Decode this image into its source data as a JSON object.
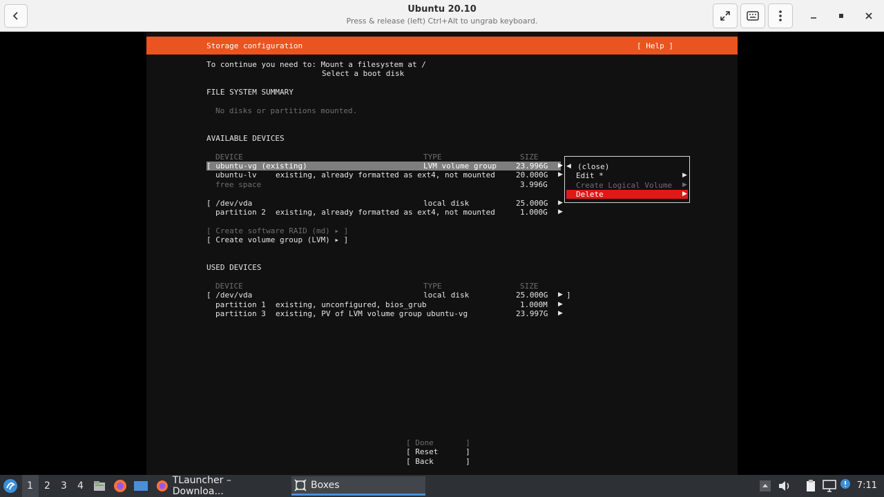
{
  "window": {
    "title": "Ubuntu 20.10",
    "subtitle": "Press & release (left) Ctrl+Alt to ungrab keyboard."
  },
  "installer": {
    "header": "Storage configuration",
    "help": "[ Help ]",
    "continue_line1": "To continue you need to: Mount a filesystem at /",
    "continue_line2": "Select a boot disk",
    "fs_summary_title": "FILE SYSTEM SUMMARY",
    "fs_summary_empty": "No disks or partitions mounted.",
    "available_title": "AVAILABLE DEVICES",
    "columns": {
      "device": "DEVICE",
      "type": "TYPE",
      "size": "SIZE"
    },
    "available": [
      {
        "device": "[ ubuntu-vg (existing)",
        "type": "LVM volume group",
        "size": "23.996G"
      },
      {
        "device": "ubuntu-lv",
        "type": "existing, already formatted as ext4, not mounted",
        "size": "20.000G"
      },
      {
        "device": "free space",
        "type": "",
        "size": "3.996G"
      },
      {
        "device": "[ /dev/vda",
        "type": "local disk",
        "size": "25.000G"
      },
      {
        "device": "partition 2",
        "type": "existing, already formatted as ext4, not mounted",
        "size": "1.000G"
      }
    ],
    "create_raid": "[ Create software RAID (md) ▸ ]",
    "create_lvm": "[ Create volume group (LVM) ▸ ]",
    "used_title": "USED DEVICES",
    "used": [
      {
        "device": "[ /dev/vda",
        "type": "local disk",
        "size": "25.000G",
        "tail": "]"
      },
      {
        "device": "partition 1",
        "type": "existing, unconfigured, bios_grub",
        "size": "1.000M"
      },
      {
        "device": "partition 3",
        "type": "existing, PV of LVM volume group ubuntu-vg",
        "size": "23.997G"
      }
    ],
    "popup": {
      "close": "(close)",
      "edit": "Edit *",
      "create_lv": "Create Logical Volume",
      "delete": "Delete"
    },
    "buttons": {
      "done": "[ Done       ]",
      "reset": "[ Reset      ]",
      "back": "[ Back       ]"
    }
  },
  "taskbar": {
    "workspaces": [
      "1",
      "2",
      "3",
      "4"
    ],
    "tasks": [
      {
        "label": "TLauncher – Downloa..."
      },
      {
        "label": "Boxes"
      }
    ],
    "clock": "7:11"
  }
}
